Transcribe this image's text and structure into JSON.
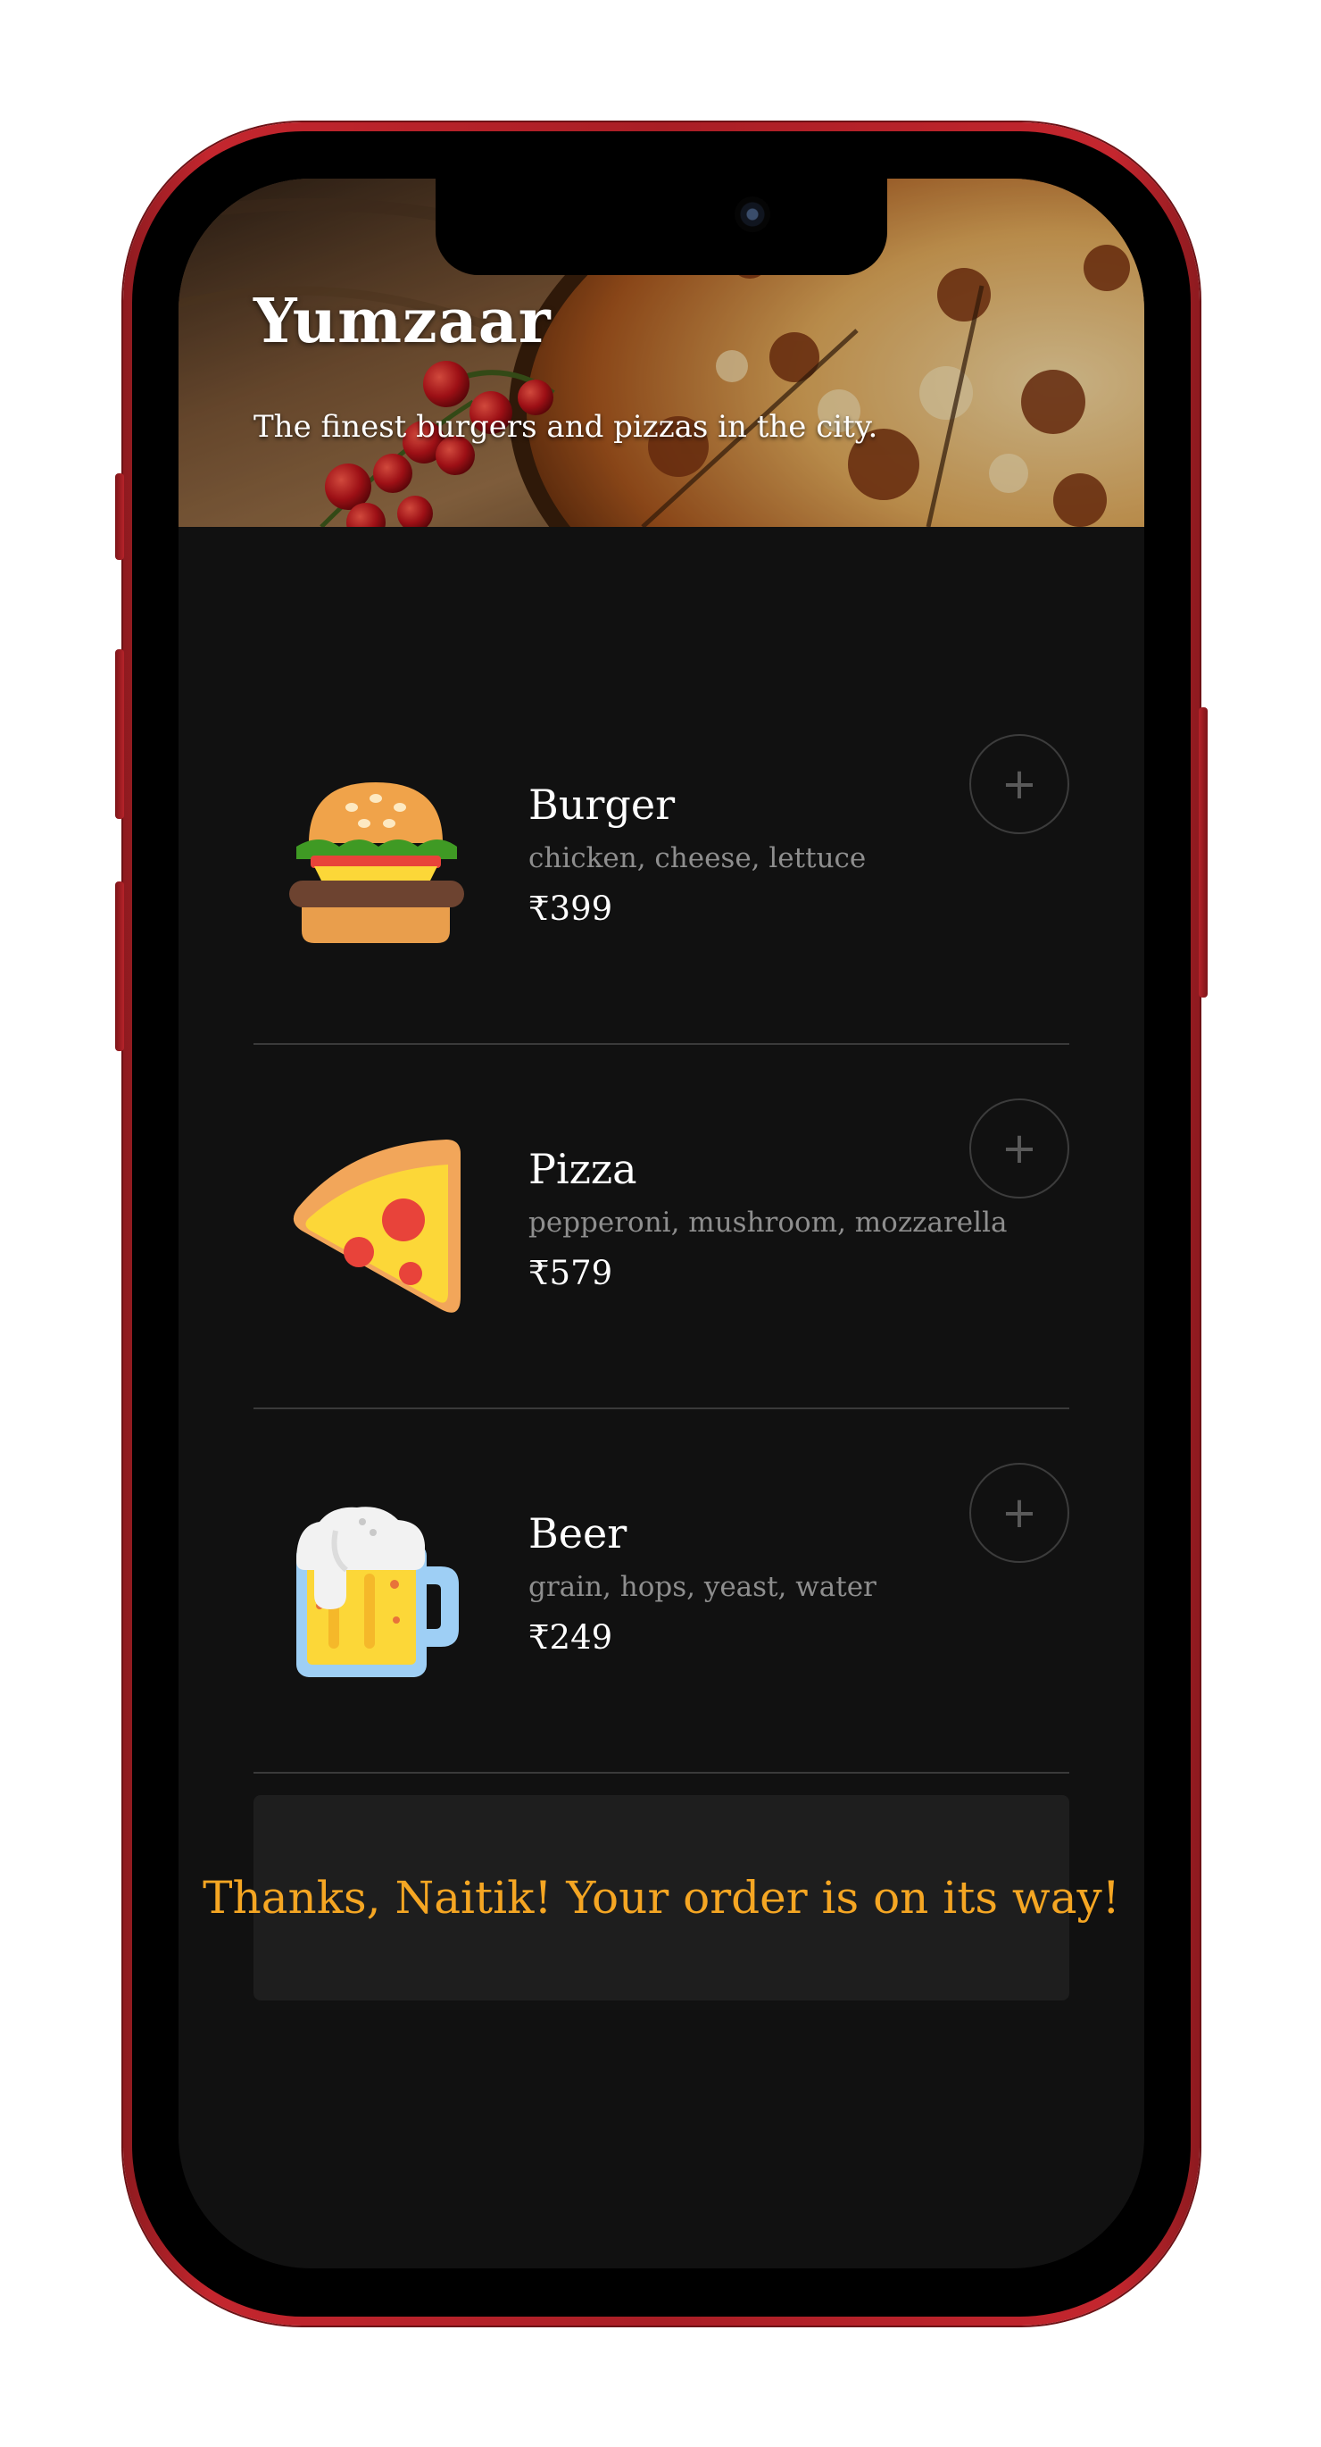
{
  "app": {
    "title": "Yumzaar",
    "tagline": "The finest burgers and pizzas in the city."
  },
  "menu": {
    "items": [
      {
        "name": "Burger",
        "description": "chicken, cheese, lettuce",
        "price": "₹399",
        "icon": "burger-icon",
        "add_label": "+"
      },
      {
        "name": "Pizza",
        "description": "pepperoni, mushroom, mozzarella",
        "price": "₹579",
        "icon": "pizza-icon",
        "add_label": "+"
      },
      {
        "name": "Beer",
        "description": "grain, hops, yeast, water",
        "price": "₹249",
        "icon": "beer-icon",
        "add_label": "+"
      }
    ]
  },
  "confirmation": {
    "message": "Thanks, Naitik! Your order is on its way!"
  },
  "colors": {
    "background": "#111111",
    "accent": "#f5a623",
    "frame": "#b7232a",
    "card": "#1e1e1e",
    "muted_text": "#8e8e8e"
  }
}
